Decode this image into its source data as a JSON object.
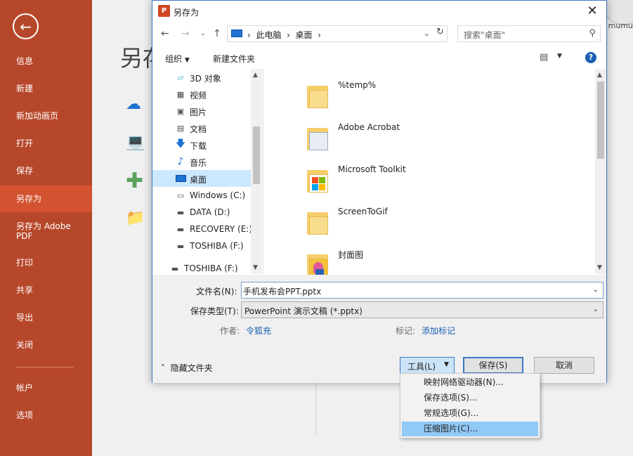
{
  "backstage": {
    "nav": [
      "信息",
      "新建",
      "新加动画页",
      "打开",
      "保存",
      "另存为",
      "另存为 Adobe PDF",
      "打印",
      "共享",
      "导出",
      "关闭",
      "帐户",
      "选项"
    ],
    "active_item": "另存为",
    "title": "另存",
    "user_fragment": "mumu"
  },
  "dialog": {
    "title": "另存为",
    "app_icon_letter": "P",
    "address": [
      "此电脑",
      "桌面"
    ],
    "search_placeholder": "搜索\"桌面\"",
    "organize_label": "组织",
    "new_folder_label": "新建文件夹",
    "nav_tree": [
      {
        "label": "3D 对象",
        "icon": "3d-objects-icon"
      },
      {
        "label": "视频",
        "icon": "video-icon"
      },
      {
        "label": "图片",
        "icon": "pictures-icon"
      },
      {
        "label": "文档",
        "icon": "documents-icon"
      },
      {
        "label": "下载",
        "icon": "download-icon"
      },
      {
        "label": "音乐",
        "icon": "music-icon"
      },
      {
        "label": "桌面",
        "icon": "desktop-icon",
        "selected": true
      },
      {
        "label": "Windows (C:)",
        "icon": "drive-icon"
      },
      {
        "label": "DATA (D:)",
        "icon": "drive-icon"
      },
      {
        "label": "RECOVERY (E:)",
        "icon": "drive-icon"
      },
      {
        "label": "TOSHIBA (F:)",
        "icon": "drive-icon"
      },
      {
        "label": "TOSHIBA (F:)",
        "icon": "drive-icon"
      }
    ],
    "files": [
      {
        "name": "%temp%",
        "icon": "folder-icon"
      },
      {
        "name": "Adobe Acrobat",
        "icon": "folder-icon"
      },
      {
        "name": "Microsoft Toolkit",
        "icon": "folder-icon"
      },
      {
        "name": "ScreenToGif",
        "icon": "folder-icon"
      },
      {
        "name": "封面图",
        "icon": "image-folder-icon"
      }
    ],
    "filename_label": "文件名(N):",
    "filename_value": "手机发布会PPT.pptx",
    "filetype_label": "保存类型(T):",
    "filetype_value": "PowerPoint 演示文稿 (*.pptx)",
    "author_label": "作者:",
    "author_value": "令狐充",
    "tags_label": "标记:",
    "tags_value": "添加标记",
    "hide_folders_label": "隐藏文件夹",
    "tools_label": "工具(L)",
    "save_label": "保存(S)",
    "cancel_label": "取消"
  },
  "tools_menu": {
    "items": [
      "映射网络驱动器(N)...",
      "保存选项(S)...",
      "常规选项(G)...",
      "压缩图片(C)..."
    ],
    "highlighted": "压缩图片(C)..."
  },
  "colors": {
    "accent": "#b7472a",
    "active_nav": "#d35230",
    "selection": "#cce8ff",
    "link": "#1a5fb4",
    "menu_highlight": "#91c9f7"
  }
}
